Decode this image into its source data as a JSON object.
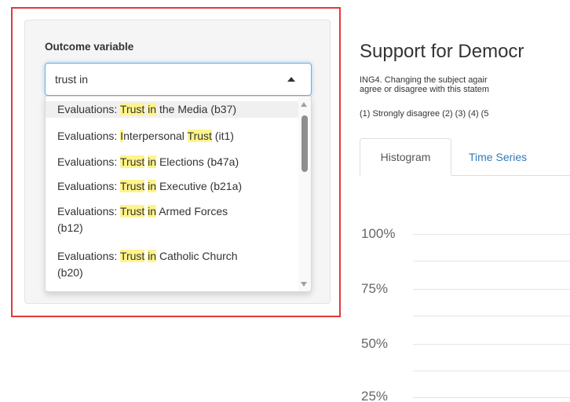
{
  "sidebar": {
    "field_label": "Outcome variable",
    "search_value": "trust in",
    "options": [
      {
        "prefix": "Evaluations: ",
        "h1": "Trust",
        "mid": " ",
        "h2": "in",
        "suffix": " the Media (b37)",
        "line2": ""
      },
      {
        "prefix": "Evaluations: ",
        "h1": "I",
        "mid": "nterpersonal ",
        "h2": "Trust",
        "suffix": " (it1)",
        "line2": ""
      },
      {
        "prefix": "Evaluations: ",
        "h1": "Trust",
        "mid": " ",
        "h2": "in",
        "suffix": " Elections (b47a)",
        "line2": ""
      },
      {
        "prefix": "Evaluations: ",
        "h1": "Trust",
        "mid": " ",
        "h2": "in",
        "suffix": " Executive (b21a)",
        "line2": ""
      },
      {
        "prefix": "Evaluations: ",
        "h1": "Trust",
        "mid": " ",
        "h2": "in",
        "suffix": " Armed Forces",
        "line2": "(b12)"
      },
      {
        "prefix": "Evaluations: ",
        "h1": "Trust",
        "mid": " ",
        "h2": "in",
        "suffix": " Catholic Church",
        "line2": "(b20)"
      }
    ]
  },
  "main": {
    "title": "Support for Democr",
    "question_line1": "ING4. Changing the subject agair",
    "question_line2": "agree or disagree with this statem",
    "scale_text": "(1) Strongly disagree (2) (3) (4) (5",
    "tabs": [
      {
        "label": "Histogram"
      },
      {
        "label": "Time Series"
      }
    ],
    "y_ticks": [
      "100%",
      "75%",
      "50%",
      "25%"
    ]
  },
  "colors": {
    "highlight": "#fff48a",
    "focus_border": "#66afe9",
    "annotation_frame": "#e03a3a",
    "link": "#337ab7"
  }
}
